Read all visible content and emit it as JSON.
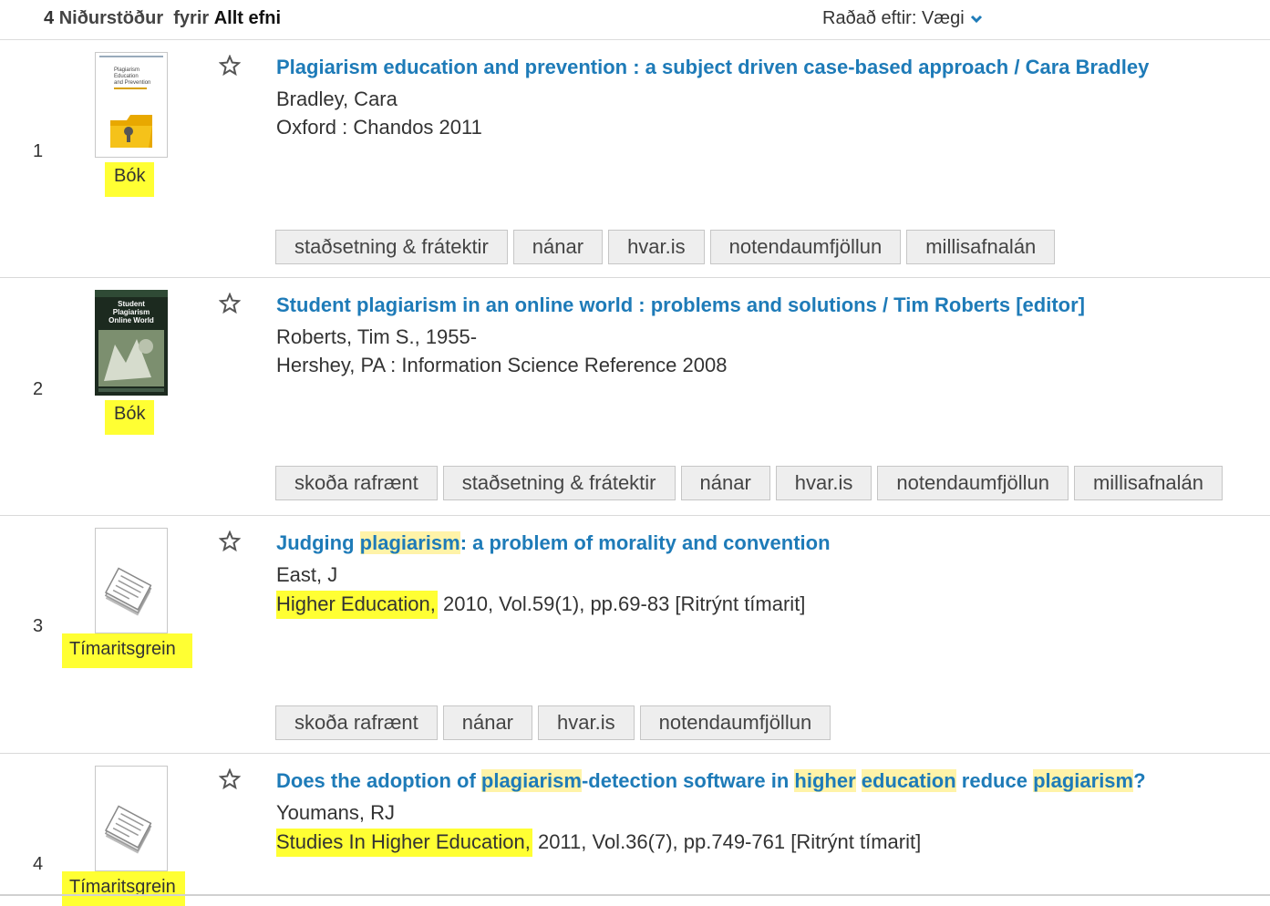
{
  "header": {
    "count": "4",
    "results_label": "Niðurstöður",
    "for_label": "fyrir",
    "scope": "Allt efni",
    "sort_label": "Raðað eftir:",
    "sort_value": "Vægi"
  },
  "results": [
    {
      "number": "1",
      "type": "Bók",
      "title": "Plagiarism education and prevention : a subject driven case-based approach / Cara Bradley",
      "author": "Bradley, Cara",
      "publisher": "Oxford : Chandos 2011",
      "cover_text": [
        "Plagiarism",
        "Education",
        "and Prevention"
      ],
      "buttons": [
        "staðsetning & frátektir",
        "nánar",
        "hvar.is",
        "notendaumfjöllun",
        "millisafnalán"
      ]
    },
    {
      "number": "2",
      "type": "Bók",
      "title": "Student plagiarism in an online world : problems and solutions / Tim Roberts [editor]",
      "author": "Roberts, Tim S., 1955-",
      "publisher": "Hershey, PA : Information Science Reference 2008",
      "cover_text": [
        "Student",
        "Plagiarism",
        "Online World"
      ],
      "buttons": [
        "skoða rafrænt",
        "staðsetning & frátektir",
        "nánar",
        "hvar.is",
        "notendaumfjöllun",
        "millisafnalán"
      ]
    },
    {
      "number": "3",
      "type": "Tímaritsgrein",
      "title_parts": [
        "Judging ",
        "plagiarism",
        ": a problem of morality and convention"
      ],
      "author": "East, J",
      "journal": "Higher Education,",
      "details": " 2010, Vol.59(1), pp.69-83 [Ritrýnt tímarit]",
      "buttons": [
        "skoða rafrænt",
        "nánar",
        "hvar.is",
        "notendaumfjöllun"
      ]
    },
    {
      "number": "4",
      "type": "Tímaritsgrein",
      "title_parts": [
        "Does the adoption of ",
        "plagiarism",
        "-detection software in ",
        "higher",
        " ",
        "education",
        " reduce ",
        "plagiarism",
        "?"
      ],
      "author": "Youmans, RJ",
      "journal": "Studies In Higher Education,",
      "details": " 2011, Vol.36(7), pp.749-761 [Ritrýnt tímarit]"
    }
  ],
  "colors": {
    "title_link": "#1e7bb8",
    "highlight_search": "#fff3a8",
    "highlight_marker": "#ffff33",
    "button_bg": "#eeeeee"
  }
}
